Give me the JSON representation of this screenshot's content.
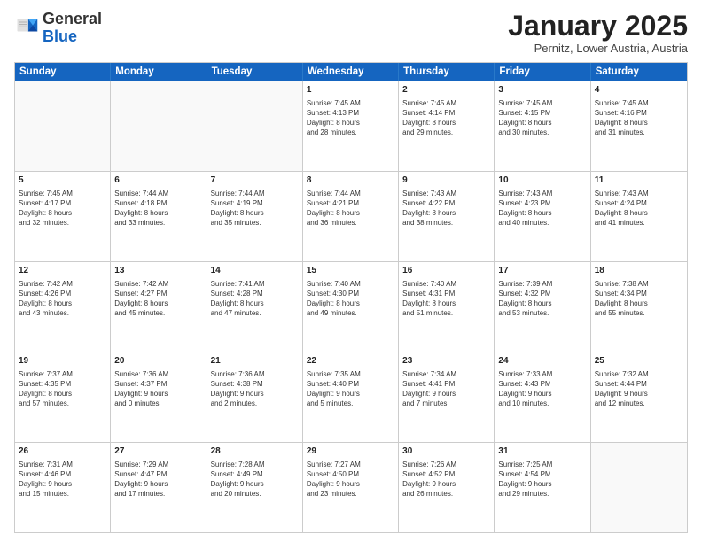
{
  "logo": {
    "general": "General",
    "blue": "Blue"
  },
  "header": {
    "month": "January 2025",
    "location": "Pernitz, Lower Austria, Austria"
  },
  "weekdays": [
    "Sunday",
    "Monday",
    "Tuesday",
    "Wednesday",
    "Thursday",
    "Friday",
    "Saturday"
  ],
  "weeks": [
    [
      {
        "day": "",
        "text": ""
      },
      {
        "day": "",
        "text": ""
      },
      {
        "day": "",
        "text": ""
      },
      {
        "day": "1",
        "text": "Sunrise: 7:45 AM\nSunset: 4:13 PM\nDaylight: 8 hours\nand 28 minutes."
      },
      {
        "day": "2",
        "text": "Sunrise: 7:45 AM\nSunset: 4:14 PM\nDaylight: 8 hours\nand 29 minutes."
      },
      {
        "day": "3",
        "text": "Sunrise: 7:45 AM\nSunset: 4:15 PM\nDaylight: 8 hours\nand 30 minutes."
      },
      {
        "day": "4",
        "text": "Sunrise: 7:45 AM\nSunset: 4:16 PM\nDaylight: 8 hours\nand 31 minutes."
      }
    ],
    [
      {
        "day": "5",
        "text": "Sunrise: 7:45 AM\nSunset: 4:17 PM\nDaylight: 8 hours\nand 32 minutes."
      },
      {
        "day": "6",
        "text": "Sunrise: 7:44 AM\nSunset: 4:18 PM\nDaylight: 8 hours\nand 33 minutes."
      },
      {
        "day": "7",
        "text": "Sunrise: 7:44 AM\nSunset: 4:19 PM\nDaylight: 8 hours\nand 35 minutes."
      },
      {
        "day": "8",
        "text": "Sunrise: 7:44 AM\nSunset: 4:21 PM\nDaylight: 8 hours\nand 36 minutes."
      },
      {
        "day": "9",
        "text": "Sunrise: 7:43 AM\nSunset: 4:22 PM\nDaylight: 8 hours\nand 38 minutes."
      },
      {
        "day": "10",
        "text": "Sunrise: 7:43 AM\nSunset: 4:23 PM\nDaylight: 8 hours\nand 40 minutes."
      },
      {
        "day": "11",
        "text": "Sunrise: 7:43 AM\nSunset: 4:24 PM\nDaylight: 8 hours\nand 41 minutes."
      }
    ],
    [
      {
        "day": "12",
        "text": "Sunrise: 7:42 AM\nSunset: 4:26 PM\nDaylight: 8 hours\nand 43 minutes."
      },
      {
        "day": "13",
        "text": "Sunrise: 7:42 AM\nSunset: 4:27 PM\nDaylight: 8 hours\nand 45 minutes."
      },
      {
        "day": "14",
        "text": "Sunrise: 7:41 AM\nSunset: 4:28 PM\nDaylight: 8 hours\nand 47 minutes."
      },
      {
        "day": "15",
        "text": "Sunrise: 7:40 AM\nSunset: 4:30 PM\nDaylight: 8 hours\nand 49 minutes."
      },
      {
        "day": "16",
        "text": "Sunrise: 7:40 AM\nSunset: 4:31 PM\nDaylight: 8 hours\nand 51 minutes."
      },
      {
        "day": "17",
        "text": "Sunrise: 7:39 AM\nSunset: 4:32 PM\nDaylight: 8 hours\nand 53 minutes."
      },
      {
        "day": "18",
        "text": "Sunrise: 7:38 AM\nSunset: 4:34 PM\nDaylight: 8 hours\nand 55 minutes."
      }
    ],
    [
      {
        "day": "19",
        "text": "Sunrise: 7:37 AM\nSunset: 4:35 PM\nDaylight: 8 hours\nand 57 minutes."
      },
      {
        "day": "20",
        "text": "Sunrise: 7:36 AM\nSunset: 4:37 PM\nDaylight: 9 hours\nand 0 minutes."
      },
      {
        "day": "21",
        "text": "Sunrise: 7:36 AM\nSunset: 4:38 PM\nDaylight: 9 hours\nand 2 minutes."
      },
      {
        "day": "22",
        "text": "Sunrise: 7:35 AM\nSunset: 4:40 PM\nDaylight: 9 hours\nand 5 minutes."
      },
      {
        "day": "23",
        "text": "Sunrise: 7:34 AM\nSunset: 4:41 PM\nDaylight: 9 hours\nand 7 minutes."
      },
      {
        "day": "24",
        "text": "Sunrise: 7:33 AM\nSunset: 4:43 PM\nDaylight: 9 hours\nand 10 minutes."
      },
      {
        "day": "25",
        "text": "Sunrise: 7:32 AM\nSunset: 4:44 PM\nDaylight: 9 hours\nand 12 minutes."
      }
    ],
    [
      {
        "day": "26",
        "text": "Sunrise: 7:31 AM\nSunset: 4:46 PM\nDaylight: 9 hours\nand 15 minutes."
      },
      {
        "day": "27",
        "text": "Sunrise: 7:29 AM\nSunset: 4:47 PM\nDaylight: 9 hours\nand 17 minutes."
      },
      {
        "day": "28",
        "text": "Sunrise: 7:28 AM\nSunset: 4:49 PM\nDaylight: 9 hours\nand 20 minutes."
      },
      {
        "day": "29",
        "text": "Sunrise: 7:27 AM\nSunset: 4:50 PM\nDaylight: 9 hours\nand 23 minutes."
      },
      {
        "day": "30",
        "text": "Sunrise: 7:26 AM\nSunset: 4:52 PM\nDaylight: 9 hours\nand 26 minutes."
      },
      {
        "day": "31",
        "text": "Sunrise: 7:25 AM\nSunset: 4:54 PM\nDaylight: 9 hours\nand 29 minutes."
      },
      {
        "day": "",
        "text": ""
      }
    ]
  ]
}
